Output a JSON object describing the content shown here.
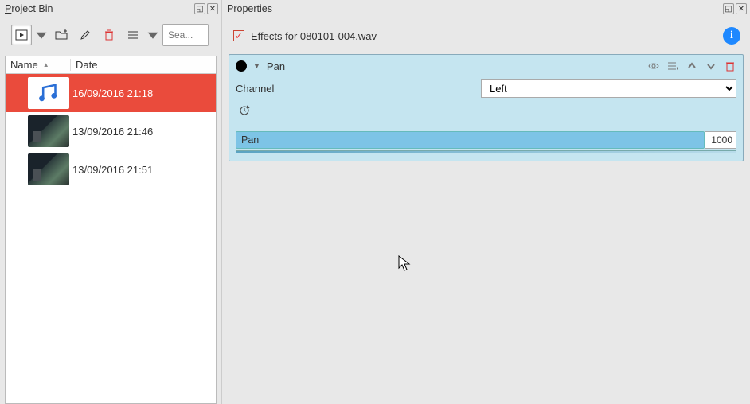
{
  "panel_left": {
    "title": "Project Bin",
    "title_accel": "P",
    "search_placeholder": "Sea...",
    "toolbar": {
      "add_clip": "add-clip",
      "add_folder": "add-folder",
      "edit": "edit",
      "delete": "delete",
      "view": "view-mode"
    },
    "columns": {
      "name": "Name",
      "date": "Date"
    },
    "items": [
      {
        "type": "audio",
        "date": "16/09/2016 21:18",
        "selected": true
      },
      {
        "type": "video",
        "date": "13/09/2016 21:46",
        "selected": false
      },
      {
        "type": "video",
        "date": "13/09/2016 21:51",
        "selected": false
      }
    ]
  },
  "panel_right": {
    "title": "Properties",
    "effects_checked": true,
    "effects_label": "Effects for 080101-004.wav",
    "info_tooltip": "i",
    "effect": {
      "name": "Pan",
      "channel_label": "Channel",
      "channel_value": "Left",
      "channel_options": [
        "Left"
      ],
      "param_label": "Pan",
      "param_value": "1000"
    }
  }
}
